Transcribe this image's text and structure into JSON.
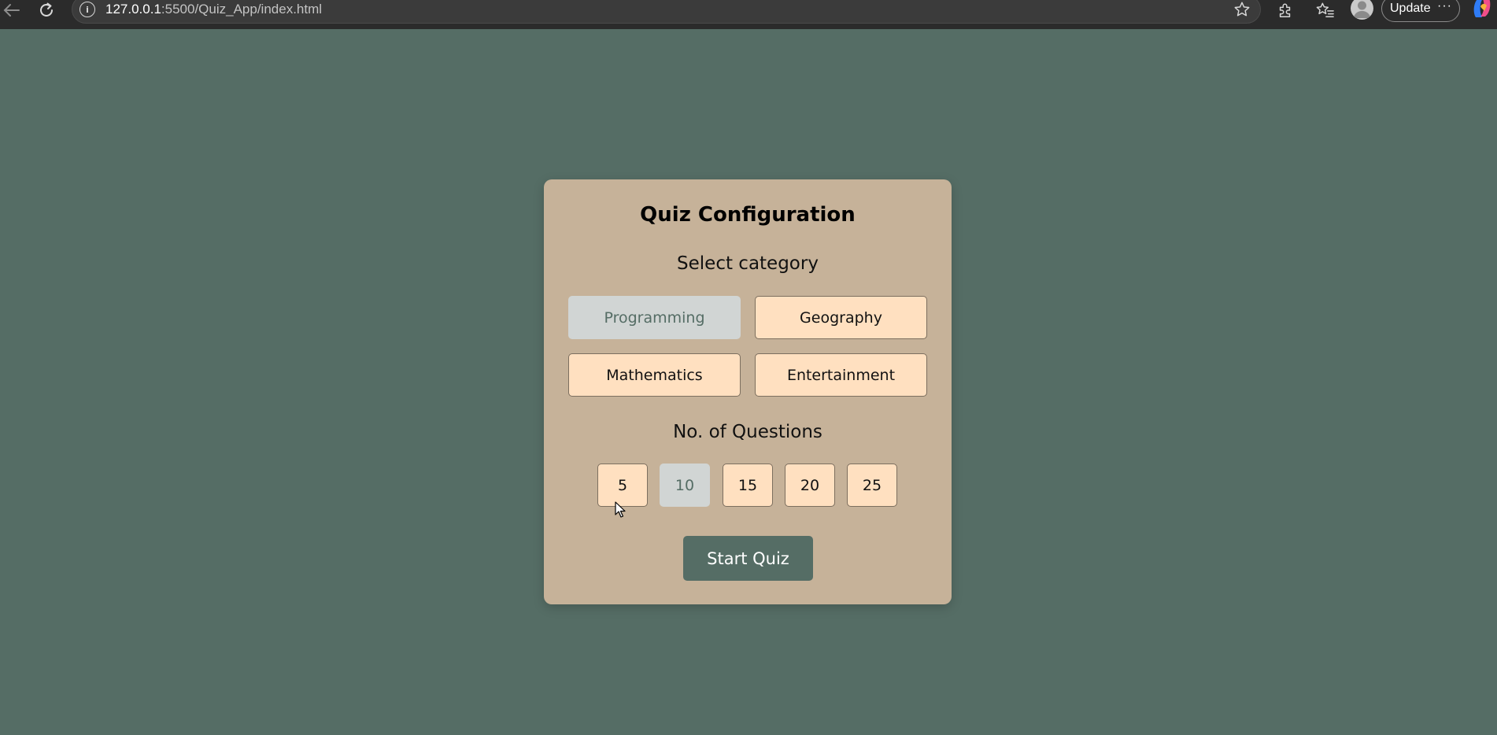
{
  "browser": {
    "url_host": "127.0.0.1",
    "url_path": ":5500/Quiz_App/index.html",
    "update_label": "Update",
    "more_label": "···"
  },
  "quiz": {
    "title": "Quiz Configuration",
    "category_label": "Select category",
    "categories": [
      {
        "label": "Programming",
        "selected": true
      },
      {
        "label": "Geography",
        "selected": false
      },
      {
        "label": "Mathematics",
        "selected": false
      },
      {
        "label": "Entertainment",
        "selected": false
      }
    ],
    "questions_label": "No. of Questions",
    "question_counts": [
      {
        "label": "5",
        "selected": false
      },
      {
        "label": "10",
        "selected": true
      },
      {
        "label": "15",
        "selected": false
      },
      {
        "label": "20",
        "selected": false
      },
      {
        "label": "25",
        "selected": false
      }
    ],
    "start_label": "Start Quiz"
  },
  "colors": {
    "page_background": "#556d65",
    "card_background": "#c6b299",
    "option_background": "#ffe0c0",
    "option_selected": "#d1d5d4",
    "primary_button": "#556d65"
  },
  "icons": [
    "back-arrow-icon",
    "reload-icon",
    "site-info-icon",
    "star-icon",
    "extensions-icon",
    "favorites-icon",
    "profile-avatar-icon",
    "copilot-icon",
    "mouse-cursor-icon"
  ]
}
